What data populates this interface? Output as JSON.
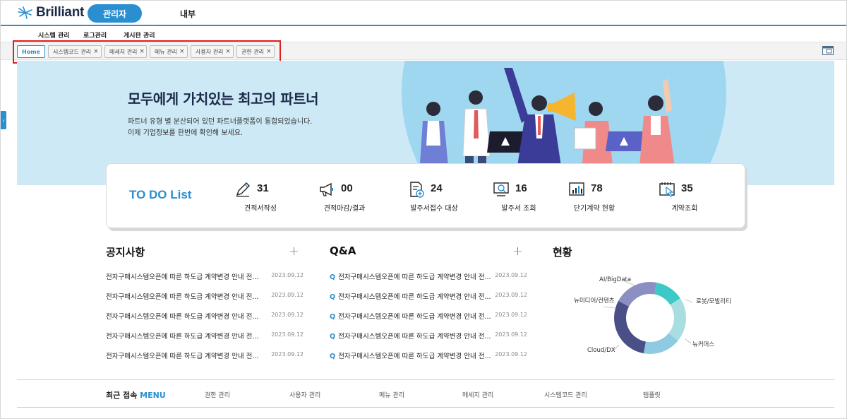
{
  "header": {
    "brand": "Brilliant",
    "admin_pill": "관리자",
    "internal_tab": "내부"
  },
  "submenu": [
    "시스템 관리",
    "로그관리",
    "게시판 관리"
  ],
  "tabs": [
    {
      "label": "Home",
      "closable": false
    },
    {
      "label": "시스템코드 관리",
      "closable": true
    },
    {
      "label": "메세지 관리",
      "closable": true
    },
    {
      "label": "메뉴 관리",
      "closable": true
    },
    {
      "label": "사용자 관리",
      "closable": true
    },
    {
      "label": "권한 관리",
      "closable": true
    }
  ],
  "tab_close_glyph": "×",
  "side_handle_glyph": "›",
  "hero": {
    "title": "모두에게 가치있는 최고의 파트너",
    "line1": "파트너 유형 별 분산되어 있던 파트너플랫폼이 통합되었습니다.",
    "line2": "이제 기업정보를 한번에 확인해 보세요."
  },
  "todo": {
    "title": "TO DO List",
    "items": [
      {
        "icon": "pencil-icon",
        "count": "31",
        "label": "견적서작성"
      },
      {
        "icon": "megaphone-icon",
        "count": "00",
        "label": "견적마감/결과"
      },
      {
        "icon": "document-plus-icon",
        "count": "24",
        "label": "발주서접수 대상"
      },
      {
        "icon": "search-monitor-icon",
        "count": "16",
        "label": "발주서 조회"
      },
      {
        "icon": "chart-icon",
        "count": "78",
        "label": "단기계약 현황"
      },
      {
        "icon": "calendar-cursor-icon",
        "count": "35",
        "label": "계약조회"
      }
    ]
  },
  "notice": {
    "title": "공지사항",
    "plus": "+",
    "rows": [
      {
        "text": "전자구매시스템오픈에 따른 하도급 계약변경 안내 전...",
        "date": "2023.09.12"
      },
      {
        "text": "전자구매시스템오픈에 따른 하도급 계약변경 안내 전...",
        "date": "2023.09.12"
      },
      {
        "text": "전자구매시스템오픈에 따른 하도급 계약변경 안내 전...",
        "date": "2023.09.12"
      },
      {
        "text": "전자구매시스템오픈에 따른 하도급 계약변경 안내 전...",
        "date": "2023.09.12"
      },
      {
        "text": "전자구매시스템오픈에 따른 하도급 계약변경 안내 전...",
        "date": "2023.09.12"
      }
    ]
  },
  "qna": {
    "title": "Q&A",
    "plus": "+",
    "q_mark": "Q",
    "rows": [
      {
        "text": "전자구매시스템오픈에 따른 하도급 계약변경 안내 전...",
        "date": "2023.09.12"
      },
      {
        "text": "전자구매시스템오픈에 따른 하도급 계약변경 안내 전...",
        "date": "2023.09.12"
      },
      {
        "text": "전자구매시스템오픈에 따른 하도급 계약변경 안내 전...",
        "date": "2023.09.12"
      },
      {
        "text": "전자구매시스템오픈에 따른 하도급 계약변경 안내 전...",
        "date": "2023.09.12"
      },
      {
        "text": "전자구매시스템오픈에 따른 하도급 계약변경 안내 전...",
        "date": "2023.09.12"
      }
    ]
  },
  "status": {
    "title": "현황",
    "segments": [
      {
        "label": "AI/BigData",
        "share": 0.13,
        "color": "#3ec9c6"
      },
      {
        "label": "로봇/모빌리티",
        "share": 0.2,
        "color": "#a9dee0"
      },
      {
        "label": "뉴커머스",
        "share": 0.17,
        "color": "#8ecbe3"
      },
      {
        "label": "Cloud/DX",
        "share": 0.3,
        "color": "#4a4f87"
      },
      {
        "label": "뉴미디어/컨텐츠",
        "share": 0.2,
        "color": "#8c8fc2"
      }
    ]
  },
  "recent": {
    "title_prefix": "최근 접속 ",
    "title_accent": "MENU",
    "items": [
      "권한 관리",
      "사용자 관리",
      "메뉴 관리",
      "메세지 관리",
      "시스템코드 관리",
      "템플릿"
    ]
  },
  "colors": {
    "accent": "#2a8fd0",
    "highlight_box": "#e02020"
  }
}
